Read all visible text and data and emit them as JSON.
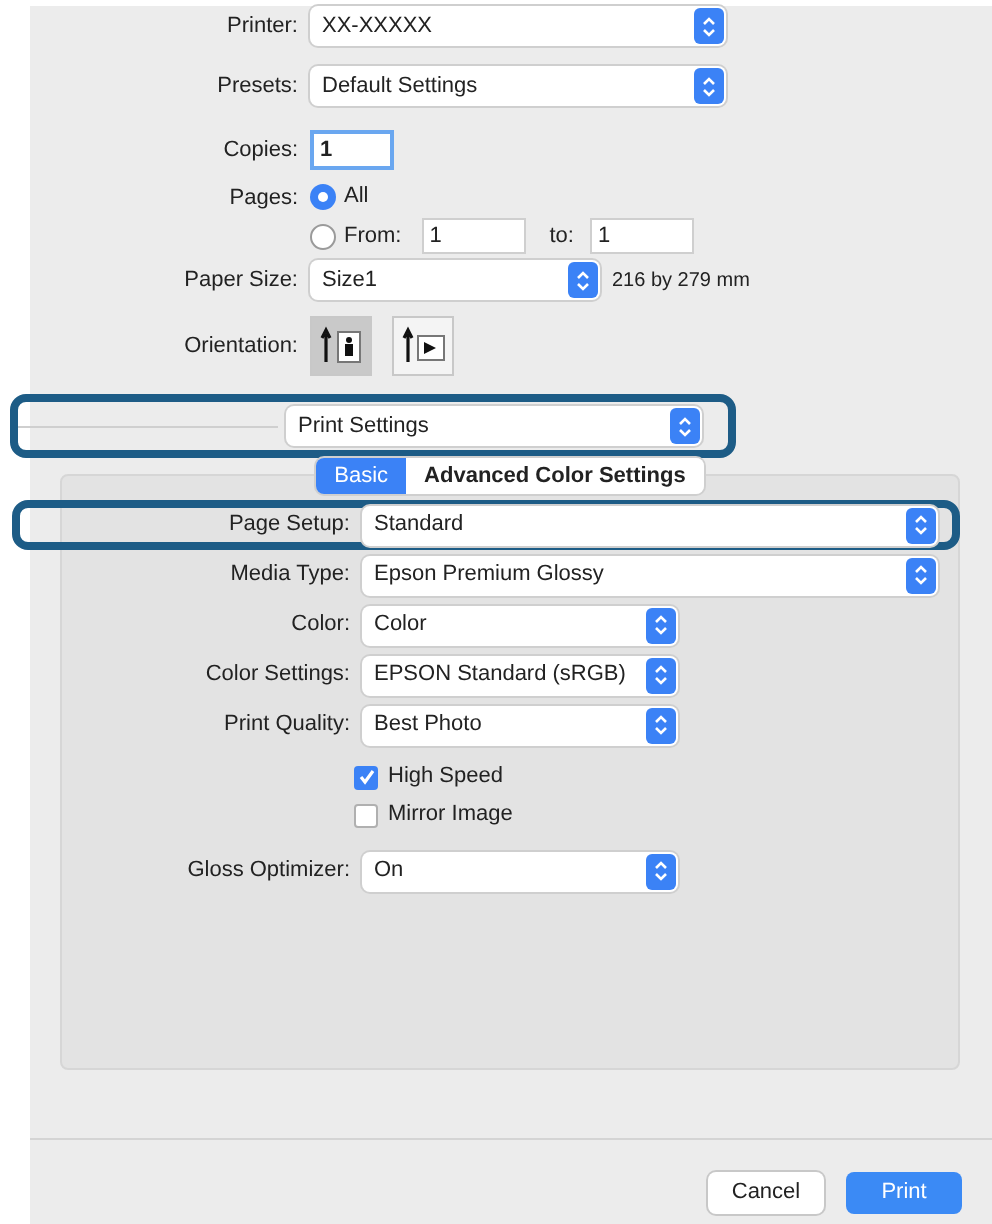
{
  "printer": {
    "label": "Printer:",
    "value": "XX-XXXXX"
  },
  "presets": {
    "label": "Presets:",
    "value": "Default Settings"
  },
  "copies": {
    "label": "Copies:",
    "value": "1"
  },
  "pages": {
    "label": "Pages:",
    "options": [
      {
        "label": "All",
        "selected": true
      },
      {
        "label": "From:",
        "selected": false
      }
    ],
    "from": "1",
    "to_label": "to:",
    "to": "1"
  },
  "paper_size": {
    "label": "Paper Size:",
    "value": "Size1",
    "dimensions": "216 by 279 mm"
  },
  "orientation": {
    "label": "Orientation:",
    "options": [
      {
        "kind": "portrait",
        "selected": true
      },
      {
        "kind": "landscape",
        "selected": false
      }
    ]
  },
  "pane_menu": {
    "value": "Print Settings",
    "highlighted": true
  },
  "tabs": [
    {
      "label": "Basic",
      "selected": true
    },
    {
      "label": "Advanced Color Settings",
      "selected": false
    }
  ],
  "settings": [
    {
      "kind": "wide-popup",
      "label": "Page Setup:",
      "value": "Standard",
      "highlighted": true
    },
    {
      "kind": "wide-popup",
      "label": "Media Type:",
      "value": "Epson Premium Glossy",
      "highlighted": false
    },
    {
      "kind": "popup",
      "label": "Color:",
      "value": "Color",
      "highlighted": false
    },
    {
      "kind": "popup",
      "label": "Color Settings:",
      "value": "EPSON Standard (sRGB)",
      "highlighted": false
    },
    {
      "kind": "popup",
      "label": "Print Quality:",
      "value": "Best Photo",
      "highlighted": false
    },
    {
      "kind": "checkbox",
      "label": "High Speed",
      "checked": true
    },
    {
      "kind": "checkbox",
      "label": "Mirror Image",
      "checked": false
    },
    {
      "kind": "popup",
      "label": "Gloss Optimizer:",
      "value": "On",
      "highlighted": false
    }
  ],
  "buttons": [
    {
      "label": "Cancel",
      "default": false
    },
    {
      "label": "Print",
      "default": true
    }
  ]
}
